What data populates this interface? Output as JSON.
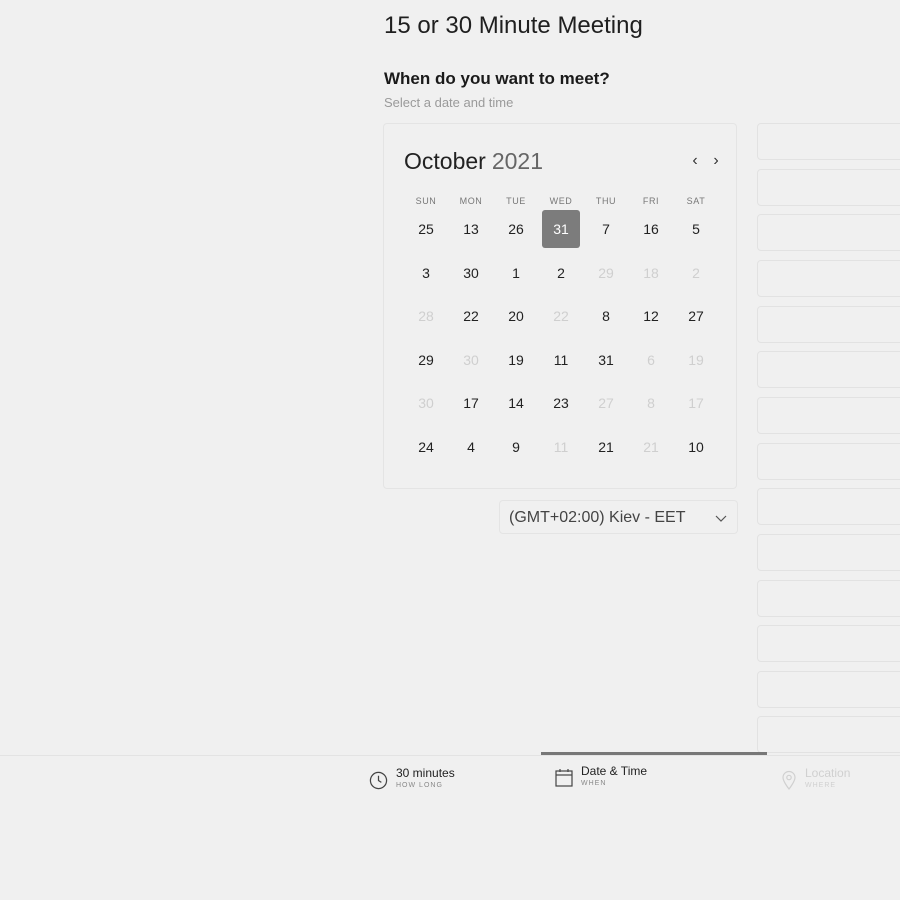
{
  "page": {
    "title": "15 or 30 Minute Meeting"
  },
  "when": {
    "question": "When do you want to meet?",
    "subtitle": "Select a date and time"
  },
  "calendar": {
    "month": "October",
    "year": "2021",
    "weekdays": [
      "SUN",
      "MON",
      "TUE",
      "WED",
      "THU",
      "FRI",
      "SAT"
    ],
    "weeks": [
      [
        {
          "d": "25",
          "m": false,
          "s": false
        },
        {
          "d": "13",
          "m": false,
          "s": false
        },
        {
          "d": "26",
          "m": false,
          "s": false
        },
        {
          "d": "31",
          "m": false,
          "s": true
        },
        {
          "d": "7",
          "m": false,
          "s": false
        },
        {
          "d": "16",
          "m": false,
          "s": false
        },
        {
          "d": "5",
          "m": false,
          "s": false
        }
      ],
      [
        {
          "d": "3",
          "m": false,
          "s": false
        },
        {
          "d": "30",
          "m": false,
          "s": false
        },
        {
          "d": "1",
          "m": false,
          "s": false
        },
        {
          "d": "2",
          "m": false,
          "s": false
        },
        {
          "d": "29",
          "m": true,
          "s": false
        },
        {
          "d": "18",
          "m": true,
          "s": false
        },
        {
          "d": "2",
          "m": true,
          "s": false
        }
      ],
      [
        {
          "d": "28",
          "m": true,
          "s": false
        },
        {
          "d": "22",
          "m": false,
          "s": false
        },
        {
          "d": "20",
          "m": false,
          "s": false
        },
        {
          "d": "22",
          "m": true,
          "s": false
        },
        {
          "d": "8",
          "m": false,
          "s": false
        },
        {
          "d": "12",
          "m": false,
          "s": false
        },
        {
          "d": "27",
          "m": false,
          "s": false
        }
      ],
      [
        {
          "d": "29",
          "m": false,
          "s": false
        },
        {
          "d": "30",
          "m": true,
          "s": false
        },
        {
          "d": "19",
          "m": false,
          "s": false
        },
        {
          "d": "11",
          "m": false,
          "s": false
        },
        {
          "d": "31",
          "m": false,
          "s": false
        },
        {
          "d": "6",
          "m": true,
          "s": false
        },
        {
          "d": "19",
          "m": true,
          "s": false
        }
      ],
      [
        {
          "d": "30",
          "m": true,
          "s": false
        },
        {
          "d": "17",
          "m": false,
          "s": false
        },
        {
          "d": "14",
          "m": false,
          "s": false
        },
        {
          "d": "23",
          "m": false,
          "s": false
        },
        {
          "d": "27",
          "m": true,
          "s": false
        },
        {
          "d": "8",
          "m": true,
          "s": false
        },
        {
          "d": "17",
          "m": true,
          "s": false
        }
      ],
      [
        {
          "d": "24",
          "m": false,
          "s": false
        },
        {
          "d": "4",
          "m": false,
          "s": false
        },
        {
          "d": "9",
          "m": false,
          "s": false
        },
        {
          "d": "11",
          "m": true,
          "s": false
        },
        {
          "d": "21",
          "m": false,
          "s": false
        },
        {
          "d": "21",
          "m": true,
          "s": false
        },
        {
          "d": "10",
          "m": false,
          "s": false
        }
      ]
    ],
    "nav_prev": "‹",
    "nav_next": "›"
  },
  "timezone": {
    "value": "(GMT+02:00) Kiev - EET"
  },
  "steps": [
    {
      "label": "30 minutes",
      "sub": "HOW LONG",
      "icon": "clock-icon",
      "active": false,
      "enabled": true
    },
    {
      "label": "Date & Time",
      "sub": "WHEN",
      "icon": "calendar-icon",
      "active": true,
      "enabled": true
    },
    {
      "label": "Location",
      "sub": "WHERE",
      "icon": "location-pin-icon",
      "active": false,
      "enabled": false
    }
  ],
  "colors": {
    "selected_day": "#7c7c7c",
    "background": "#f0f0f0",
    "active_step_bar": "#777777"
  }
}
